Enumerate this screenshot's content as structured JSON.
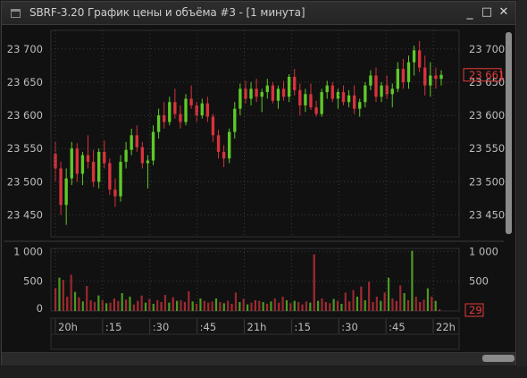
{
  "window": {
    "title": "SBRF-3.20 График цены и объёма #3 - [1 минута]",
    "minimize_glyph": "_",
    "maximize_glyph": "□",
    "close_glyph": "✕"
  },
  "colors": {
    "background": "#111111",
    "up_candle": "#5fc928",
    "down_candle": "#d8333d",
    "grid": "#3a3a3a",
    "axis_text": "#bdbdbd",
    "last_marker": "#e53b3b"
  },
  "chart_data": [
    {
      "type": "candlestick",
      "title": "",
      "yticks": [
        "23 700",
        "23 650",
        "23 600",
        "23 550",
        "23 500",
        "23 450"
      ],
      "ytick_values": [
        23700,
        23650,
        23600,
        23550,
        23500,
        23450
      ],
      "ylim": [
        23417,
        23728
      ],
      "last_price_label": "23 661",
      "last_price": 23661,
      "grid": true,
      "candles": [
        [
          23542,
          23560,
          23500,
          23520
        ],
        [
          23520,
          23530,
          23450,
          23465
        ],
        [
          23465,
          23520,
          23435,
          23505
        ],
        [
          23505,
          23560,
          23495,
          23550
        ],
        [
          23550,
          23558,
          23500,
          23512
        ],
        [
          23512,
          23545,
          23495,
          23540
        ],
        [
          23540,
          23570,
          23520,
          23530
        ],
        [
          23530,
          23548,
          23492,
          23500
        ],
        [
          23500,
          23550,
          23490,
          23545
        ],
        [
          23545,
          23562,
          23520,
          23528
        ],
        [
          23528,
          23535,
          23480,
          23488
        ],
        [
          23488,
          23505,
          23462,
          23478
        ],
        [
          23478,
          23540,
          23470,
          23530
        ],
        [
          23530,
          23560,
          23520,
          23548
        ],
        [
          23548,
          23580,
          23540,
          23570
        ],
        [
          23570,
          23585,
          23545,
          23552
        ],
        [
          23552,
          23560,
          23520,
          23528
        ],
        [
          23528,
          23540,
          23490,
          23532
        ],
        [
          23532,
          23585,
          23525,
          23575
        ],
        [
          23575,
          23610,
          23565,
          23600
        ],
        [
          23600,
          23620,
          23580,
          23590
        ],
        [
          23590,
          23628,
          23585,
          23620
        ],
        [
          23620,
          23640,
          23595,
          23602
        ],
        [
          23602,
          23615,
          23580,
          23590
        ],
        [
          23590,
          23632,
          23585,
          23625
        ],
        [
          23625,
          23645,
          23610,
          23615
        ],
        [
          23615,
          23620,
          23590,
          23600
        ],
        [
          23600,
          23625,
          23595,
          23618
        ],
        [
          23618,
          23628,
          23590,
          23598
        ],
        [
          23598,
          23602,
          23560,
          23570
        ],
        [
          23570,
          23578,
          23535,
          23545
        ],
        [
          23545,
          23555,
          23522,
          23535
        ],
        [
          23535,
          23580,
          23528,
          23575
        ],
        [
          23575,
          23620,
          23565,
          23610
        ],
        [
          23610,
          23648,
          23600,
          23640
        ],
        [
          23640,
          23652,
          23618,
          23625
        ],
        [
          23625,
          23650,
          23615,
          23640
        ],
        [
          23640,
          23655,
          23620,
          23628
        ],
        [
          23628,
          23640,
          23605,
          23635
        ],
        [
          23635,
          23655,
          23625,
          23645
        ],
        [
          23645,
          23650,
          23618,
          23622
        ],
        [
          23622,
          23645,
          23610,
          23640
        ],
        [
          23640,
          23652,
          23622,
          23628
        ],
        [
          23628,
          23662,
          23620,
          23658
        ],
        [
          23658,
          23670,
          23630,
          23638
        ],
        [
          23638,
          23648,
          23600,
          23615
        ],
        [
          23615,
          23640,
          23605,
          23632
        ],
        [
          23632,
          23648,
          23608,
          23612
        ],
        [
          23612,
          23622,
          23598,
          23602
        ],
        [
          23602,
          23640,
          23598,
          23635
        ],
        [
          23635,
          23652,
          23625,
          23645
        ],
        [
          23645,
          23650,
          23620,
          23625
        ],
        [
          23625,
          23640,
          23610,
          23635
        ],
        [
          23635,
          23645,
          23615,
          23620
        ],
        [
          23620,
          23638,
          23612,
          23630
        ],
        [
          23630,
          23645,
          23602,
          23610
        ],
        [
          23610,
          23625,
          23598,
          23620
        ],
        [
          23620,
          23650,
          23612,
          23645
        ],
        [
          23645,
          23668,
          23638,
          23660
        ],
        [
          23660,
          23672,
          23620,
          23628
        ],
        [
          23628,
          23650,
          23620,
          23645
        ],
        [
          23645,
          23660,
          23625,
          23632
        ],
        [
          23632,
          23648,
          23612,
          23640
        ],
        [
          23640,
          23680,
          23635,
          23670
        ],
        [
          23670,
          23685,
          23640,
          23650
        ],
        [
          23650,
          23690,
          23640,
          23680
        ],
        [
          23680,
          23705,
          23660,
          23698
        ],
        [
          23698,
          23712,
          23665,
          23672
        ],
        [
          23672,
          23690,
          23630,
          23645
        ],
        [
          23645,
          23680,
          23628,
          23660
        ],
        [
          23660,
          23672,
          23640,
          23655
        ],
        [
          23655,
          23668,
          23645,
          23661
        ]
      ]
    },
    {
      "type": "bar",
      "title": "",
      "yticks": [
        "1 000",
        "500",
        "0"
      ],
      "ytick_values": [
        1000,
        500,
        0
      ],
      "ylim": [
        0,
        1050
      ],
      "last_volume_label": "29",
      "last_volume": 29,
      "volumes": [
        380,
        560,
        520,
        240,
        610,
        320,
        230,
        160,
        420,
        180,
        150,
        260,
        180,
        130,
        140,
        210,
        170,
        300,
        190,
        240,
        110,
        170,
        260,
        140,
        200,
        120,
        180,
        150,
        270,
        140,
        230,
        170,
        180,
        150,
        330,
        160,
        120,
        210,
        170,
        140,
        160,
        210,
        150,
        130,
        170,
        120,
        310,
        150,
        200,
        110,
        140,
        180,
        170,
        150,
        120,
        160,
        210,
        140,
        240,
        180,
        130,
        170,
        150,
        110,
        160,
        140,
        950,
        170,
        210,
        150,
        130,
        200,
        170,
        120,
        310,
        160,
        350,
        240,
        410,
        180,
        490,
        150,
        240,
        170,
        310,
        560,
        210,
        170,
        430,
        300,
        180,
        1010,
        240,
        150,
        190,
        380,
        240,
        170,
        29
      ]
    }
  ],
  "time_axis": {
    "labels": [
      "20h",
      ":15",
      ":30",
      ":45",
      "21h",
      ":15",
      ":30",
      ":45",
      "22h"
    ]
  }
}
